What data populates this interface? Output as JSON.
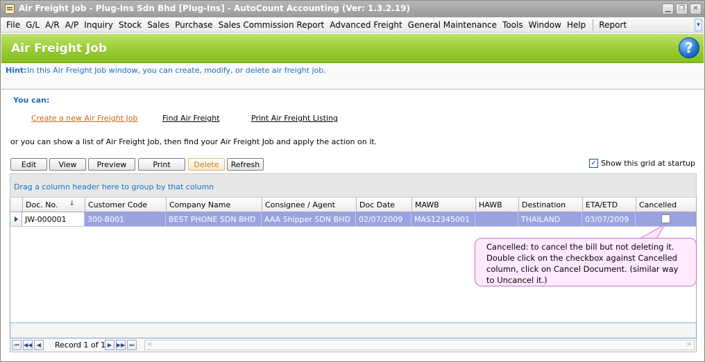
{
  "window": {
    "title": "Air Freight Job - Plug-Ins Sdn Bhd [Plug-Ins] - AutoCount Accounting (Ver: 1.3.2.19)",
    "app_icon": "document-icon",
    "controls": {
      "minimize": "minimize-icon",
      "restore": "restore-icon",
      "close": "close-icon"
    }
  },
  "menu": {
    "items": [
      "File",
      "G/L",
      "A/R",
      "A/P",
      "Inquiry",
      "Stock",
      "Sales",
      "Purchase",
      "Sales Commission Report",
      "Advanced Freight",
      "General Maintenance",
      "Tools",
      "Window",
      "Help"
    ],
    "after_separator": "Report"
  },
  "banner": {
    "title": "Air Freight Job",
    "help_glyph": "?"
  },
  "hint": {
    "label": "Hint:",
    "text": "In this Air Freight Job window, you can create, modify, or delete air freight job."
  },
  "body": {
    "you_can": "You can:",
    "links": {
      "create": "Create a new Air Freight Job",
      "find": "Find Air Freight",
      "print": "Print Air Freight Listing"
    },
    "or_text": "or you can show a list of Air Freight Job, then find your Air Freight Job and apply the action on it."
  },
  "toolbar": {
    "edit": "Edit",
    "view": "View",
    "preview": "Preview",
    "print": "Print",
    "delete": "Delete",
    "refresh": "Refresh",
    "show_grid_label": "Show this grid at startup",
    "show_grid_checked": true,
    "check_glyph": "✓"
  },
  "grid": {
    "group_hint": "Drag a column header here to group by that column",
    "columns": [
      "Doc. No.",
      "Customer Code",
      "Company Name",
      "Consignee / Agent",
      "Doc Date",
      "MAWB",
      "HAWB",
      "Destination",
      "ETA/ETD",
      "Cancelled"
    ],
    "sort_glyph": "↓",
    "rows": [
      {
        "doc_no": "JW-000001",
        "customer_code": "300-B001",
        "company_name": "BEST PHONE SDN BHD",
        "consignee": "AAA Shipper SDN BHD",
        "doc_date": "02/07/2009",
        "mawb": "MAS12345001",
        "hawb": "",
        "destination": "THAILAND",
        "eta_etd": "03/07/2009",
        "cancelled": false
      }
    ]
  },
  "navigator": {
    "record_text": "Record 1 of 1",
    "first": "⏮",
    "prev_page": "◀◀",
    "prev": "◀",
    "next": "▶",
    "next_page": "▶▶",
    "last": "⏭",
    "scroll_left": "<",
    "scroll_right": ">"
  },
  "callout": {
    "text": "Cancelled: to cancel the bill but not deleting it. Double click on the checkbox against Cancelled column, click on Cancel Document. (similar way to Uncancel it.)"
  }
}
